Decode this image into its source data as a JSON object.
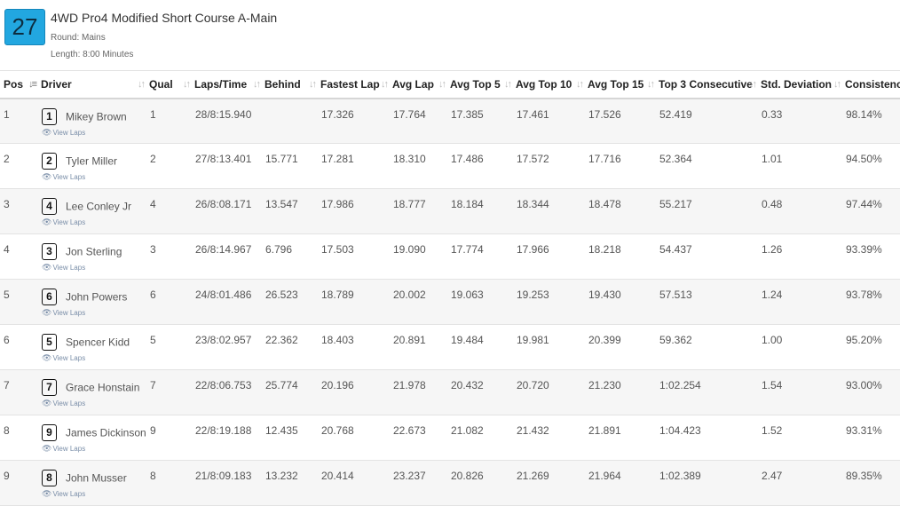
{
  "race": {
    "number": "27",
    "title": "4WD Pro4 Modified Short Course A-Main",
    "round": "Round: Mains",
    "length": "Length: 8:00 Minutes"
  },
  "columns": [
    "Pos",
    "Driver",
    "Qual",
    "Laps/Time",
    "Behind",
    "Fastest Lap",
    "Avg Lap",
    "Avg Top 5",
    "Avg Top 10",
    "Avg Top 15",
    "Top 3 Consecutive",
    "Std. Deviation",
    "Consistency"
  ],
  "view_laps_label": "View Laps",
  "rows": [
    {
      "pos": "1",
      "car": "1",
      "driver": "Mikey Brown",
      "qual": "1",
      "laps": "28/8:15.940",
      "behind": "",
      "fastest": "17.326",
      "avg": "17.764",
      "top5": "17.385",
      "top10": "17.461",
      "top15": "17.526",
      "top3c": "52.419",
      "std": "0.33",
      "cons": "98.14%"
    },
    {
      "pos": "2",
      "car": "2",
      "driver": "Tyler Miller",
      "qual": "2",
      "laps": "27/8:13.401",
      "behind": "15.771",
      "fastest": "17.281",
      "avg": "18.310",
      "top5": "17.486",
      "top10": "17.572",
      "top15": "17.716",
      "top3c": "52.364",
      "std": "1.01",
      "cons": "94.50%"
    },
    {
      "pos": "3",
      "car": "4",
      "driver": "Lee Conley Jr",
      "qual": "4",
      "laps": "26/8:08.171",
      "behind": "13.547",
      "fastest": "17.986",
      "avg": "18.777",
      "top5": "18.184",
      "top10": "18.344",
      "top15": "18.478",
      "top3c": "55.217",
      "std": "0.48",
      "cons": "97.44%"
    },
    {
      "pos": "4",
      "car": "3",
      "driver": "Jon Sterling",
      "qual": "3",
      "laps": "26/8:14.967",
      "behind": "6.796",
      "fastest": "17.503",
      "avg": "19.090",
      "top5": "17.774",
      "top10": "17.966",
      "top15": "18.218",
      "top3c": "54.437",
      "std": "1.26",
      "cons": "93.39%"
    },
    {
      "pos": "5",
      "car": "6",
      "driver": "John Powers",
      "qual": "6",
      "laps": "24/8:01.486",
      "behind": "26.523",
      "fastest": "18.789",
      "avg": "20.002",
      "top5": "19.063",
      "top10": "19.253",
      "top15": "19.430",
      "top3c": "57.513",
      "std": "1.24",
      "cons": "93.78%"
    },
    {
      "pos": "6",
      "car": "5",
      "driver": "Spencer Kidd",
      "qual": "5",
      "laps": "23/8:02.957",
      "behind": "22.362",
      "fastest": "18.403",
      "avg": "20.891",
      "top5": "19.484",
      "top10": "19.981",
      "top15": "20.399",
      "top3c": "59.362",
      "std": "1.00",
      "cons": "95.20%"
    },
    {
      "pos": "7",
      "car": "7",
      "driver": "Grace Honstain",
      "qual": "7",
      "laps": "22/8:06.753",
      "behind": "25.774",
      "fastest": "20.196",
      "avg": "21.978",
      "top5": "20.432",
      "top10": "20.720",
      "top15": "21.230",
      "top3c": "1:02.254",
      "std": "1.54",
      "cons": "93.00%"
    },
    {
      "pos": "8",
      "car": "9",
      "driver": "James Dickinson",
      "qual": "9",
      "laps": "22/8:19.188",
      "behind": "12.435",
      "fastest": "20.768",
      "avg": "22.673",
      "top5": "21.082",
      "top10": "21.432",
      "top15": "21.891",
      "top3c": "1:04.423",
      "std": "1.52",
      "cons": "93.31%"
    },
    {
      "pos": "9",
      "car": "8",
      "driver": "John Musser",
      "qual": "8",
      "laps": "21/8:09.183",
      "behind": "13.232",
      "fastest": "20.414",
      "avg": "23.237",
      "top5": "20.826",
      "top10": "21.269",
      "top15": "21.964",
      "top3c": "1:02.389",
      "std": "2.47",
      "cons": "89.35%"
    }
  ],
  "colors": {
    "badge": "#22a7e0"
  }
}
